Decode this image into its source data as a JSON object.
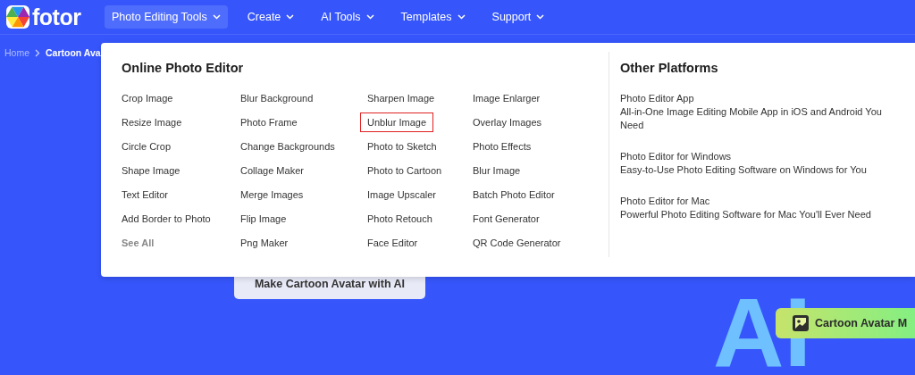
{
  "logo": {
    "text": "fotor"
  },
  "nav": [
    {
      "label": "Photo Editing Tools",
      "selected": true
    },
    {
      "label": "Create",
      "selected": false
    },
    {
      "label": "AI Tools",
      "selected": false
    },
    {
      "label": "Templates",
      "selected": false
    },
    {
      "label": "Support",
      "selected": false
    }
  ],
  "breadcrumb": [
    "Home",
    "Cartoon Ava"
  ],
  "dropdown": {
    "title": "Online Photo Editor",
    "columns": [
      [
        {
          "label": "Crop Image",
          "kind": "tool",
          "highlighted": false
        },
        {
          "label": "Resize Image",
          "kind": "tool",
          "highlighted": false
        },
        {
          "label": "Circle Crop",
          "kind": "tool",
          "highlighted": false
        },
        {
          "label": "Shape Image",
          "kind": "tool",
          "highlighted": false
        },
        {
          "label": "Text Editor",
          "kind": "tool",
          "highlighted": false
        },
        {
          "label": "Add Border to Photo",
          "kind": "tool",
          "highlighted": false
        },
        {
          "label": "See All",
          "kind": "more",
          "highlighted": false
        }
      ],
      [
        {
          "label": "Blur Background",
          "kind": "tool",
          "highlighted": false
        },
        {
          "label": "Photo Frame",
          "kind": "tool",
          "highlighted": false
        },
        {
          "label": "Change Backgrounds",
          "kind": "tool",
          "highlighted": false
        },
        {
          "label": "Collage Maker",
          "kind": "tool",
          "highlighted": false
        },
        {
          "label": "Merge Images",
          "kind": "tool",
          "highlighted": false
        },
        {
          "label": "Flip Image",
          "kind": "tool",
          "highlighted": false
        },
        {
          "label": "Png Maker",
          "kind": "tool",
          "highlighted": false
        }
      ],
      [
        {
          "label": "Sharpen Image",
          "kind": "tool",
          "highlighted": false
        },
        {
          "label": "Unblur Image",
          "kind": "tool",
          "highlighted": true
        },
        {
          "label": "Photo to Sketch",
          "kind": "tool",
          "highlighted": false
        },
        {
          "label": "Photo to Cartoon",
          "kind": "tool",
          "highlighted": false
        },
        {
          "label": "Image Upscaler",
          "kind": "tool",
          "highlighted": false
        },
        {
          "label": "Photo Retouch",
          "kind": "tool",
          "highlighted": false
        },
        {
          "label": "Face Editor",
          "kind": "tool",
          "highlighted": false
        }
      ],
      [
        {
          "label": "Image Enlarger",
          "kind": "tool",
          "highlighted": false
        },
        {
          "label": "Overlay Images",
          "kind": "tool",
          "highlighted": false
        },
        {
          "label": "Photo Effects",
          "kind": "tool",
          "highlighted": false
        },
        {
          "label": "Blur Image",
          "kind": "tool",
          "highlighted": false
        },
        {
          "label": "Batch Photo Editor",
          "kind": "tool",
          "highlighted": false
        },
        {
          "label": "Font Generator",
          "kind": "tool",
          "highlighted": false
        },
        {
          "label": "QR Code Generator",
          "kind": "tool",
          "highlighted": false
        }
      ]
    ],
    "platforms_title": "Other Platforms",
    "platforms": [
      {
        "name": "Photo Editor App",
        "description": "All-in-One Image Editing Mobile App in iOS and Android You Need"
      },
      {
        "name": "Photo Editor for Windows",
        "description": "Easy-to-Use Photo Editing Software on Windows for You"
      },
      {
        "name": "Photo Editor for Mac",
        "description": "Powerful Photo Editing Software for Mac You'll Ever Need"
      }
    ]
  },
  "hero": {
    "button": "Make Cartoon Avatar with AI",
    "big_text": "AI",
    "badge": "Cartoon Avatar M"
  }
}
